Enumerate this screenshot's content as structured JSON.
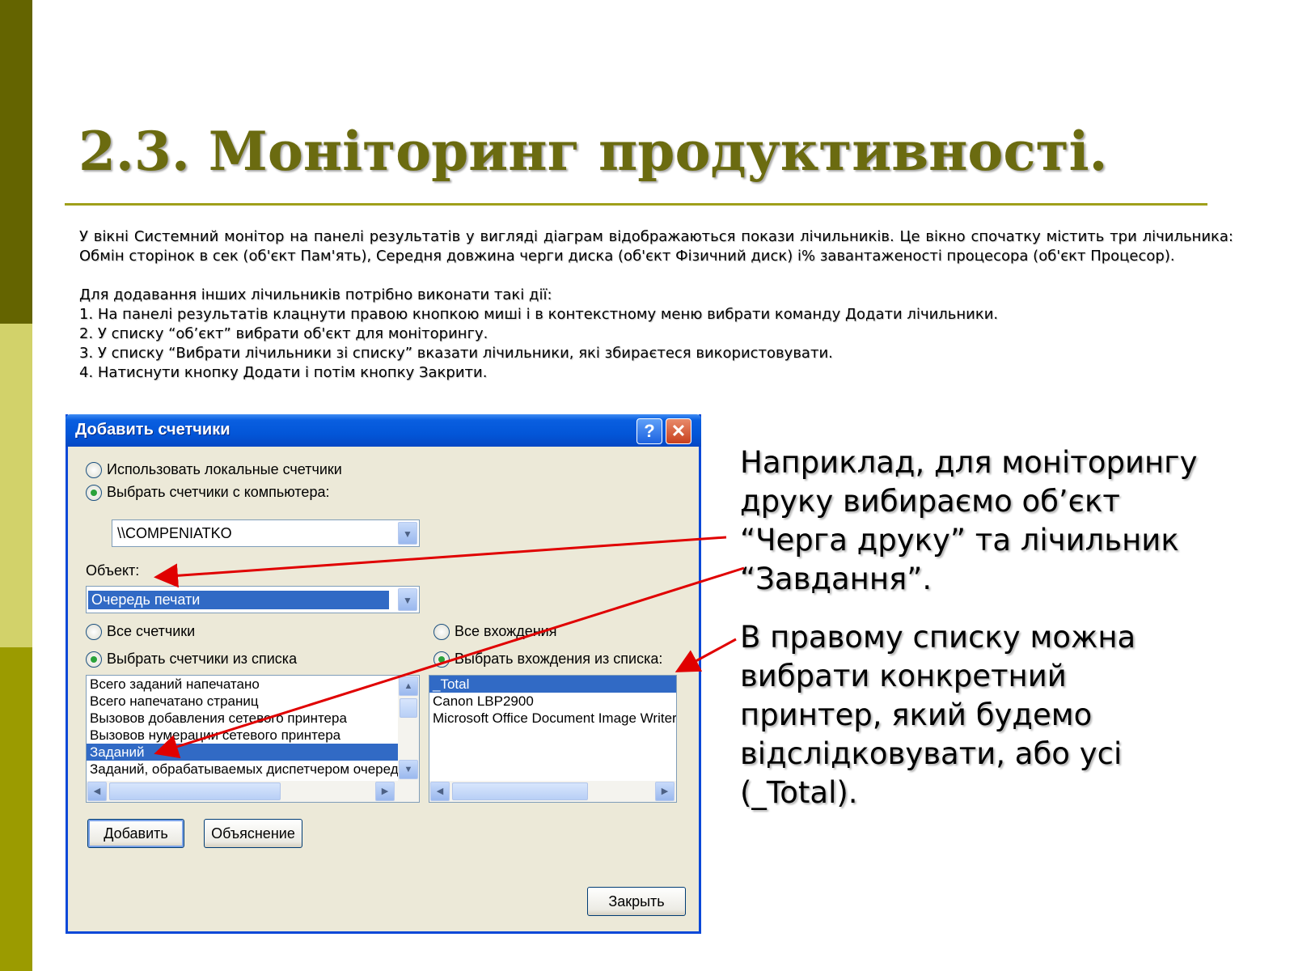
{
  "slide": {
    "title": "2.3. Моніторинг продуктивності.",
    "paragraph1": "У вікні Системний монітор на панелі результатів у вигляді діаграм відображаються покази лічильників. Це вікно спочатку містить три лічильника: Обмін сторінок в сек (об'єкт Пам'ять), Середня довжина черги диска (об'єкт Фізичний диск) і% завантаженості процесора (об'єкт Процесор).",
    "steps_intro": "Для додавання інших лічильників потрібно виконати такі дії:",
    "steps": [
      "1. На панелі результатів клацнути правою кнопкою миші і в контекстному меню вибрати команду Додати лічильники.",
      "2. У списку “об’єкт” вибрати об'єкт для моніторингу.",
      "3. У списку “Вибрати лічильники зі списку” вказати лічильники, які збираєтеся використовувати.",
      "4. Натиснути кнопку Додати і потім кнопку Закрити."
    ],
    "callout1": [
      "Наприклад, для моніторингу",
      "друку вибираємо об’єкт",
      "“Черга друку” та лічильник",
      "“Завдання”."
    ],
    "callout2": [
      "В правому списку можна",
      "вибрати конкретний",
      "принтер, який будемо",
      "відслідковувати, або усі",
      "(_Total)."
    ]
  },
  "dialog": {
    "title": "Добавить счетчики",
    "help_glyph": "?",
    "close_glyph": "✕",
    "radio_local": "Использовать локальные счетчики",
    "radio_computer": "Выбрать счетчики с компьютера:",
    "computer_value": "\\\\COMPENIATKO",
    "object_label": "Объект:",
    "object_value": "Очередь печати",
    "radio_all_counters": "Все счетчики",
    "radio_select_counters": "Выбрать счетчики из списка",
    "radio_all_instances": "Все вхождения",
    "radio_select_instances": "Выбрать вхождения из списка:",
    "counters": [
      "Всего заданий напечатано",
      "Всего напечатано страниц",
      "Вызовов добавления сетевого принтера",
      "Вызовов нумерации сетевого принтера",
      "Заданий",
      "Заданий, обрабатываемых диспетчером очереди"
    ],
    "selected_counter": "Заданий",
    "instances": [
      "_Total",
      "Canon LBP2900",
      "Microsoft Office Document Image Writer"
    ],
    "selected_instance": "_Total",
    "add_button": "Добавить",
    "explain_button": "Объяснение",
    "close_button": "Закрыть"
  },
  "colors": {
    "title": "#6b6b10",
    "sidebar_dark": "#646400",
    "sidebar_light": "#d2d26a",
    "sidebar_mid": "#9b9b00",
    "arrow": "#e00000",
    "selection": "#316ac5"
  }
}
